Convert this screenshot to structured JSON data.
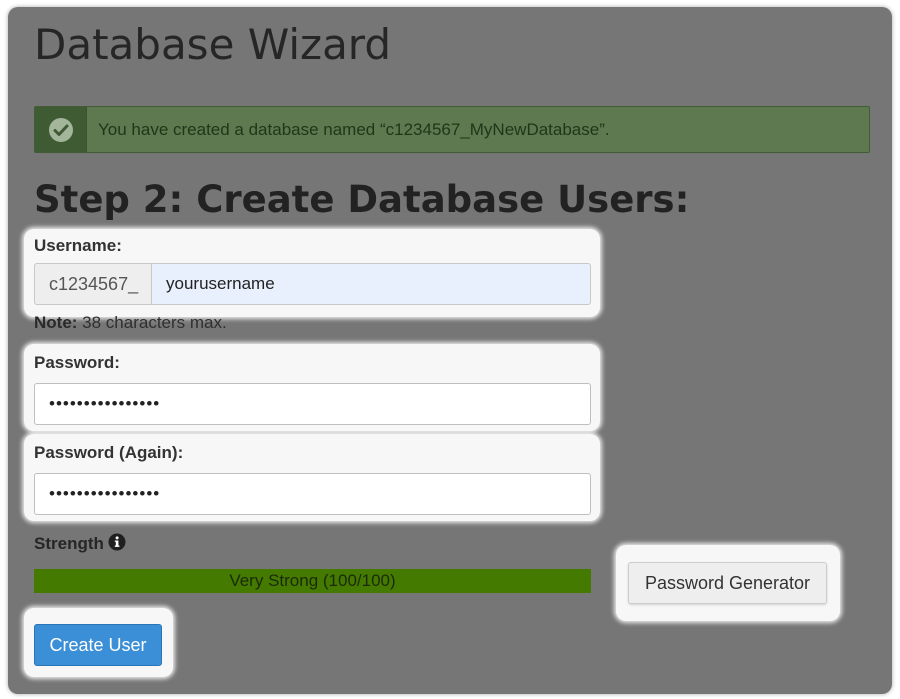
{
  "page": {
    "title": "Database Wizard"
  },
  "alert": {
    "icon": "check-circle-icon",
    "message": "You have created a database named “c1234567_MyNewDatabase”."
  },
  "step": {
    "heading": "Step 2: Create Database Users:"
  },
  "username": {
    "label": "Username:",
    "prefix": "c1234567_",
    "value": "yourusername",
    "note_bold": "Note:",
    "note_text": " 38 characters max."
  },
  "password": {
    "label": "Password:",
    "value": "••••••••••••••••"
  },
  "password_again": {
    "label": "Password (Again):",
    "value": "••••••••••••••••"
  },
  "strength": {
    "label": "Strength",
    "icon": "info-icon",
    "text": "Very Strong (100/100)",
    "score": 100,
    "max": 100
  },
  "buttons": {
    "create_user": "Create User",
    "password_generator": "Password Generator"
  },
  "colors": {
    "primary_button": "#3a8fd7",
    "strength_bar": "#4f8a00",
    "success_alert": "#5e7850"
  }
}
